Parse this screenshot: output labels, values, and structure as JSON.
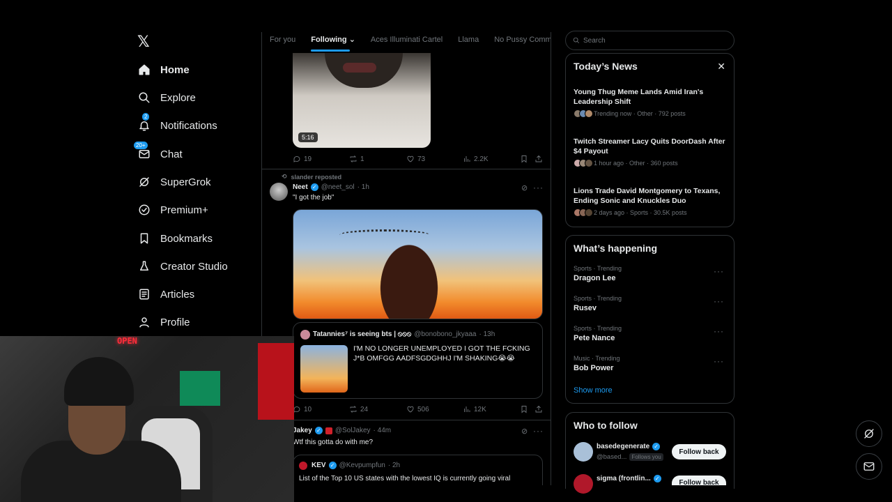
{
  "nav": {
    "logo": "𝕏",
    "items": [
      {
        "label": "Home"
      },
      {
        "label": "Explore"
      },
      {
        "label": "Notifications",
        "badge": "2"
      },
      {
        "label": "Chat",
        "badge": "20+"
      },
      {
        "label": "SuperGrok"
      },
      {
        "label": "Premium+"
      },
      {
        "label": "Bookmarks"
      },
      {
        "label": "Creator Studio"
      },
      {
        "label": "Articles"
      },
      {
        "label": "Profile"
      }
    ]
  },
  "tabs": [
    "For you",
    "Following",
    "Aces Illuminati Cartel",
    "Llama",
    "No Pussy Comme"
  ],
  "post1": {
    "duration": "5:16",
    "replies": "19",
    "reposts": "1",
    "likes": "73",
    "views": "2.2K"
  },
  "post2": {
    "repost_by": "slander reposted",
    "name": "Neet",
    "handle": "@neet_sol",
    "time": "· 1h",
    "text": "\"I got the job\"",
    "quote": {
      "name": "Tatannies⁷ is seeing bts | ⦸⦸⦸",
      "handle": "@bonobono_jkyaaa",
      "time": "· 13h",
      "text": "I'M NO LONGER UNEMPLOYED I GOT THE FCKING J*B OMFGG AADFSGDGHHJ I'M SHAKING😭😭"
    },
    "replies": "10",
    "reposts": "24",
    "likes": "506",
    "views": "12K"
  },
  "post3": {
    "name": "Jakey",
    "handle": "@SolJakey",
    "time": "· 44m",
    "text": "Wtf this gotta do with me?",
    "quote": {
      "name": "KEV",
      "handle": "@Kevpumpfun",
      "time": "· 2h",
      "text": "List of the Top 10 US states with the lowest IQ is currently going viral"
    }
  },
  "search": {
    "placeholder": "Search"
  },
  "news": {
    "title": "Today’s News",
    "close": "✕",
    "items": [
      {
        "title": "Young Thug Meme Lands Amid Iran's Leadership Shift",
        "meta": "Trending now · Other · 792 posts"
      },
      {
        "title": "Twitch Streamer Lacy Quits DoorDash After $4 Payout",
        "meta": "1 hour ago · Other · 360 posts"
      },
      {
        "title": "Lions Trade David Montgomery to Texans, Ending Sonic and Knuckles Duo",
        "meta": "2 days ago · Sports · 30.5K posts"
      }
    ]
  },
  "happening": {
    "title": "What’s happening",
    "items": [
      {
        "category": "Sports · Trending",
        "name": "Dragon Lee"
      },
      {
        "category": "Sports · Trending",
        "name": "Rusev"
      },
      {
        "category": "Sports · Trending",
        "name": "Pete Nance"
      },
      {
        "category": "Music · Trending",
        "name": "Bob Power"
      }
    ],
    "show_more": "Show more"
  },
  "follow": {
    "title": "Who to follow",
    "items": [
      {
        "name": "basedegenerate",
        "handle": "@based...",
        "tag": "Follows you",
        "button": "Follow back"
      },
      {
        "name": "sigma (frontlin...",
        "button": "Follow back"
      }
    ]
  },
  "webcam": {
    "sign": "OPEN"
  },
  "colors": {
    "accent": "#1d9bf0",
    "background": "#000000",
    "border": "#2f3336"
  }
}
